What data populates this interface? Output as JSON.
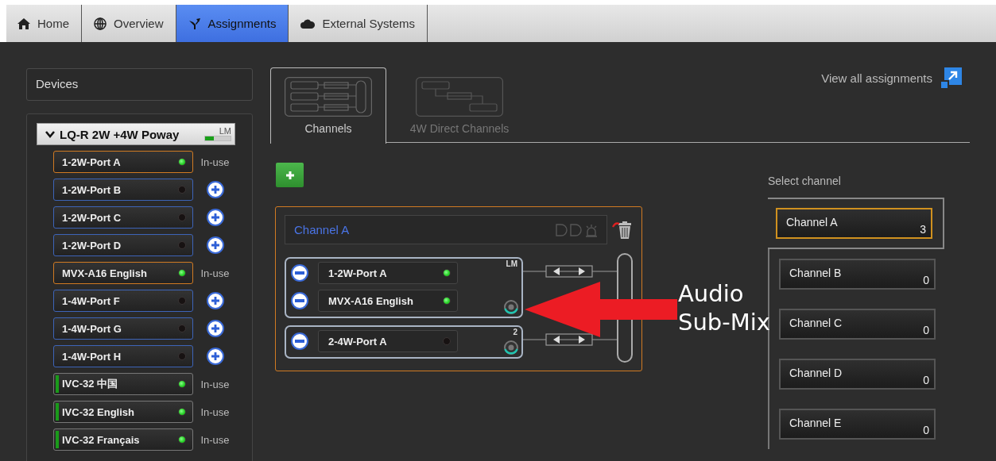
{
  "nav_tabs": [
    {
      "label": "Home",
      "selected": false
    },
    {
      "label": "Overview",
      "selected": false
    },
    {
      "label": "Assignments",
      "selected": true
    },
    {
      "label": "External Systems",
      "selected": false
    }
  ],
  "devices": {
    "title": "Devices",
    "device": {
      "name": "LQ-R 2W +4W Poway",
      "expanded": true,
      "badge": "LM",
      "level": 0.35,
      "ports": [
        {
          "name": "1-2W-Port A",
          "kind": "assigned",
          "led_on": true,
          "status": "In-use"
        },
        {
          "name": "1-2W-Port B",
          "kind": "available",
          "led_on": false
        },
        {
          "name": "1-2W-Port C",
          "kind": "available",
          "led_on": false
        },
        {
          "name": "1-2W-Port D",
          "kind": "available",
          "led_on": false
        },
        {
          "name": "MVX-A16 English",
          "kind": "assigned",
          "led_on": true,
          "status": "In-use"
        },
        {
          "name": "1-4W-Port F",
          "kind": "available",
          "led_on": false
        },
        {
          "name": "1-4W-Port G",
          "kind": "available",
          "led_on": false
        },
        {
          "name": "1-4W-Port H",
          "kind": "available",
          "led_on": false
        },
        {
          "name": "IVC-32 中国",
          "kind": "ivc",
          "led_on": true,
          "status": "In-use"
        },
        {
          "name": "IVC-32 English",
          "kind": "ivc",
          "led_on": true,
          "status": "In-use"
        },
        {
          "name": "IVC-32 Français",
          "kind": "ivc",
          "led_on": true,
          "status": "In-use"
        }
      ]
    }
  },
  "view_tabs": [
    {
      "label": "Channels",
      "selected": true
    },
    {
      "label": "4W Direct Channels",
      "selected": false
    }
  ],
  "view_all_link": "View all assignments",
  "channel": {
    "name": "Channel A",
    "groups": [
      {
        "badge": "LM",
        "members": [
          {
            "name": "1-2W-Port A",
            "led_on": true
          },
          {
            "name": "MVX-A16 English",
            "led_on": true
          }
        ]
      },
      {
        "badge": "2",
        "members": [
          {
            "name": "2-4W-Port A",
            "led_on": false
          }
        ]
      }
    ]
  },
  "annotation": {
    "lines": [
      "Audio",
      "Sub-Mix"
    ]
  },
  "channel_select": {
    "label": "Select channel",
    "channels": [
      {
        "name": "Channel A",
        "count": "3",
        "selected": true
      },
      {
        "name": "Channel B",
        "count": "0",
        "selected": false
      },
      {
        "name": "Channel C",
        "count": "0",
        "selected": false
      },
      {
        "name": "Channel D",
        "count": "0",
        "selected": false
      },
      {
        "name": "Channel E",
        "count": "0",
        "selected": false
      }
    ]
  }
}
